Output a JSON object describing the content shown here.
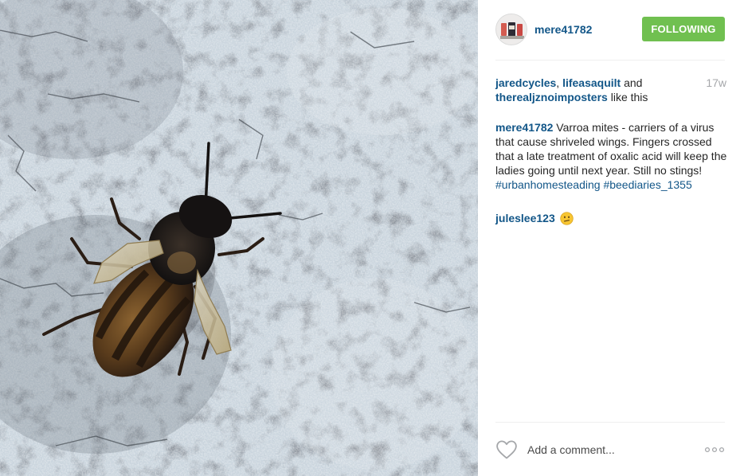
{
  "photo": {
    "alt_icon": "bee-photo"
  },
  "header": {
    "username": "mere41782",
    "follow_label": "FOLLOWING",
    "avatar_icon": "user-avatar"
  },
  "likes": {
    "users": [
      "jaredcycles",
      "lifeasaquilt",
      "therealjznoimposters"
    ],
    "sep": ", ",
    "and": " and ",
    "suffix": " like this"
  },
  "timestamp": "17w",
  "caption": {
    "username": "mere41782",
    "text": " Varroa mites - carriers of a virus that cause shriveled wings. Fingers crossed that a late treatment of oxalic acid will keep the ladies going until next year. Still no stings!",
    "hashtags": [
      "#urbanhomesteading",
      "#beediaries_1355"
    ]
  },
  "comments": [
    {
      "username": "juleslee123",
      "emoji": "confused-face-emoji"
    }
  ],
  "footer": {
    "comment_placeholder": "Add a comment...",
    "like_icon": "heart-icon",
    "more_icon": "more-options-icon"
  },
  "colors": {
    "link": "#125688",
    "follow_bg": "#70c050",
    "timestamp": "#a5a7aa",
    "divider": "#efefef"
  }
}
